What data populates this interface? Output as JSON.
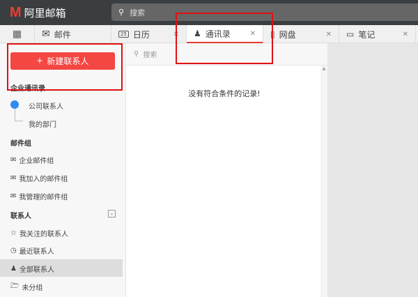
{
  "app": {
    "logo_letter": "M",
    "title": "阿里邮箱",
    "search_placeholder": "搜索"
  },
  "tabs": [
    {
      "label": "邮件"
    },
    {
      "label": "日历",
      "calendar_day": "25"
    },
    {
      "label": "通讯录",
      "active": true
    },
    {
      "label": "网盘"
    },
    {
      "label": "笔记"
    }
  ],
  "sidebar": {
    "new_contact": "新建联系人",
    "org_title": "企业通讯录",
    "company_contacts": "公司联系人",
    "my_department": "我的部门",
    "groups_title": "邮件组",
    "groups": [
      "企业邮件组",
      "我加入的邮件组",
      "我管理的邮件组"
    ],
    "contacts_title": "联系人",
    "contacts": [
      "我关注的联系人",
      "最近联系人",
      "全部联系人",
      "未分组"
    ]
  },
  "list": {
    "search_placeholder": "搜索",
    "empty_message": "没有符合条件的记录!"
  },
  "colors": {
    "accent": "#f44642",
    "topbar": "#3b3e41",
    "dot": "#2f8cf0"
  }
}
